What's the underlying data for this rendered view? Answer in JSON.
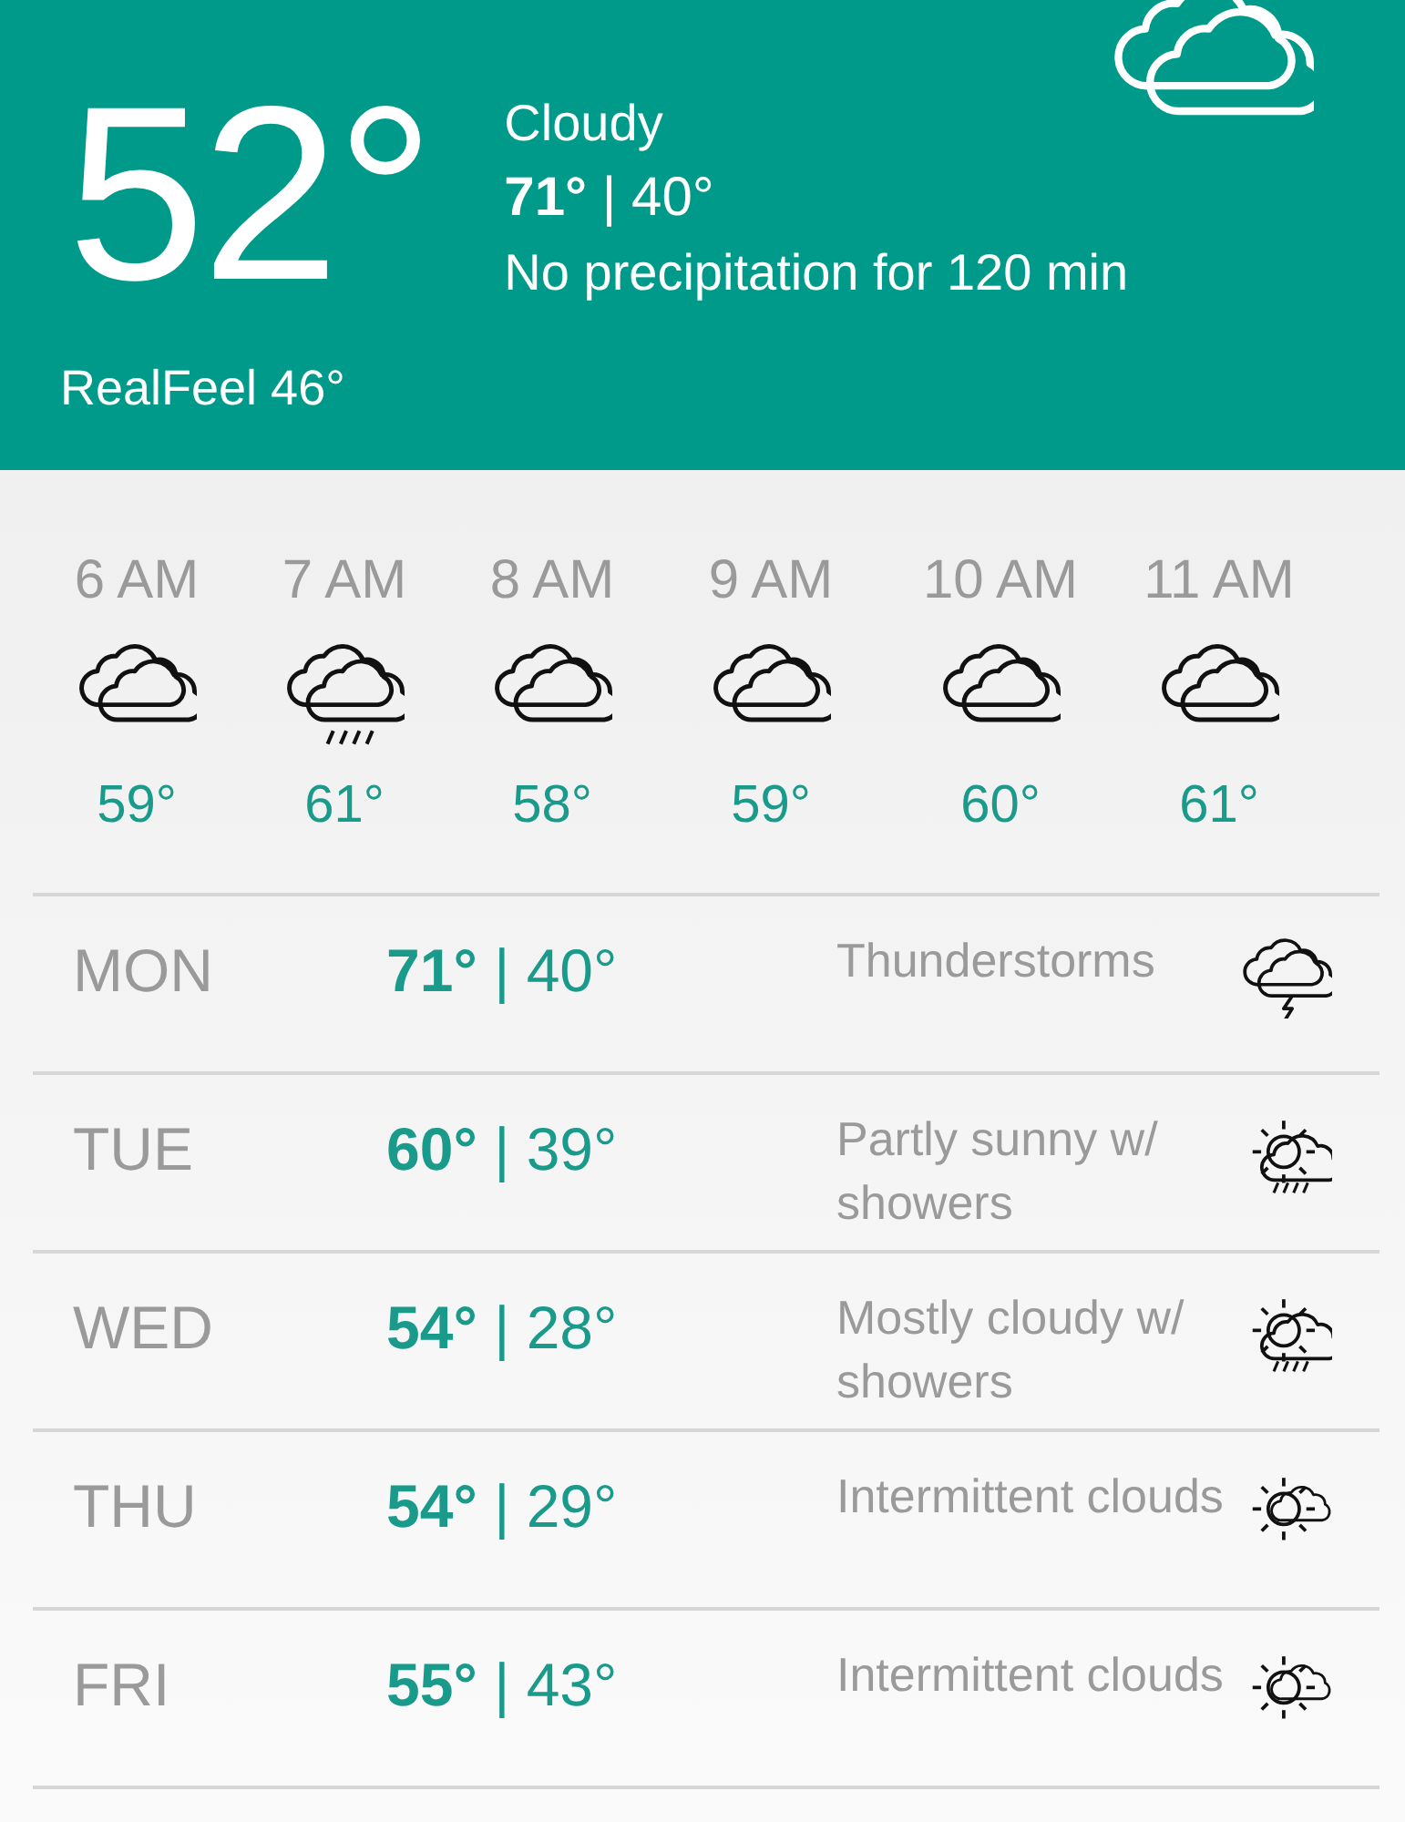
{
  "current": {
    "temperature": "52°",
    "condition": "Cloudy",
    "high_low": "**71°** | 40°",
    "precipitation": "No precipitation for 120 min",
    "realfeel": "RealFeel 46°",
    "kind": "cloudy"
  },
  "hourly": [
    {
      "time": "6 AM",
      "kind": "cloudy",
      "temperature": "59°"
    },
    {
      "time": "7 AM",
      "kind": "rain",
      "temperature": "61°"
    },
    {
      "time": "8 AM",
      "kind": "cloudy",
      "temperature": "58°"
    },
    {
      "time": "9 AM",
      "kind": "cloudy",
      "temperature": "59°"
    },
    {
      "time": "10 AM",
      "kind": "cloudy",
      "temperature": "60°"
    },
    {
      "time": "11 AM",
      "kind": "cloudy",
      "temperature": "61°"
    }
  ],
  "daily": [
    {
      "day": "MON",
      "high_low": "**71°** | 40°",
      "condition": "Thunderstorms",
      "kind": "thunder"
    },
    {
      "day": "TUE",
      "high_low": "**60°** | 39°",
      "condition": "Partly sunny w/ showers",
      "kind": "sun-rain"
    },
    {
      "day": "WED",
      "high_low": "**54°** | 28°",
      "condition": "Mostly cloudy w/ showers",
      "kind": "sun-rain"
    },
    {
      "day": "THU",
      "high_low": "**54°** | 29°",
      "condition": "Intermittent clouds",
      "kind": "sun-cloud"
    },
    {
      "day": "FRI",
      "high_low": "**55°** | 43°",
      "condition": "Intermittent clouds",
      "kind": "sun-cloud"
    }
  ]
}
